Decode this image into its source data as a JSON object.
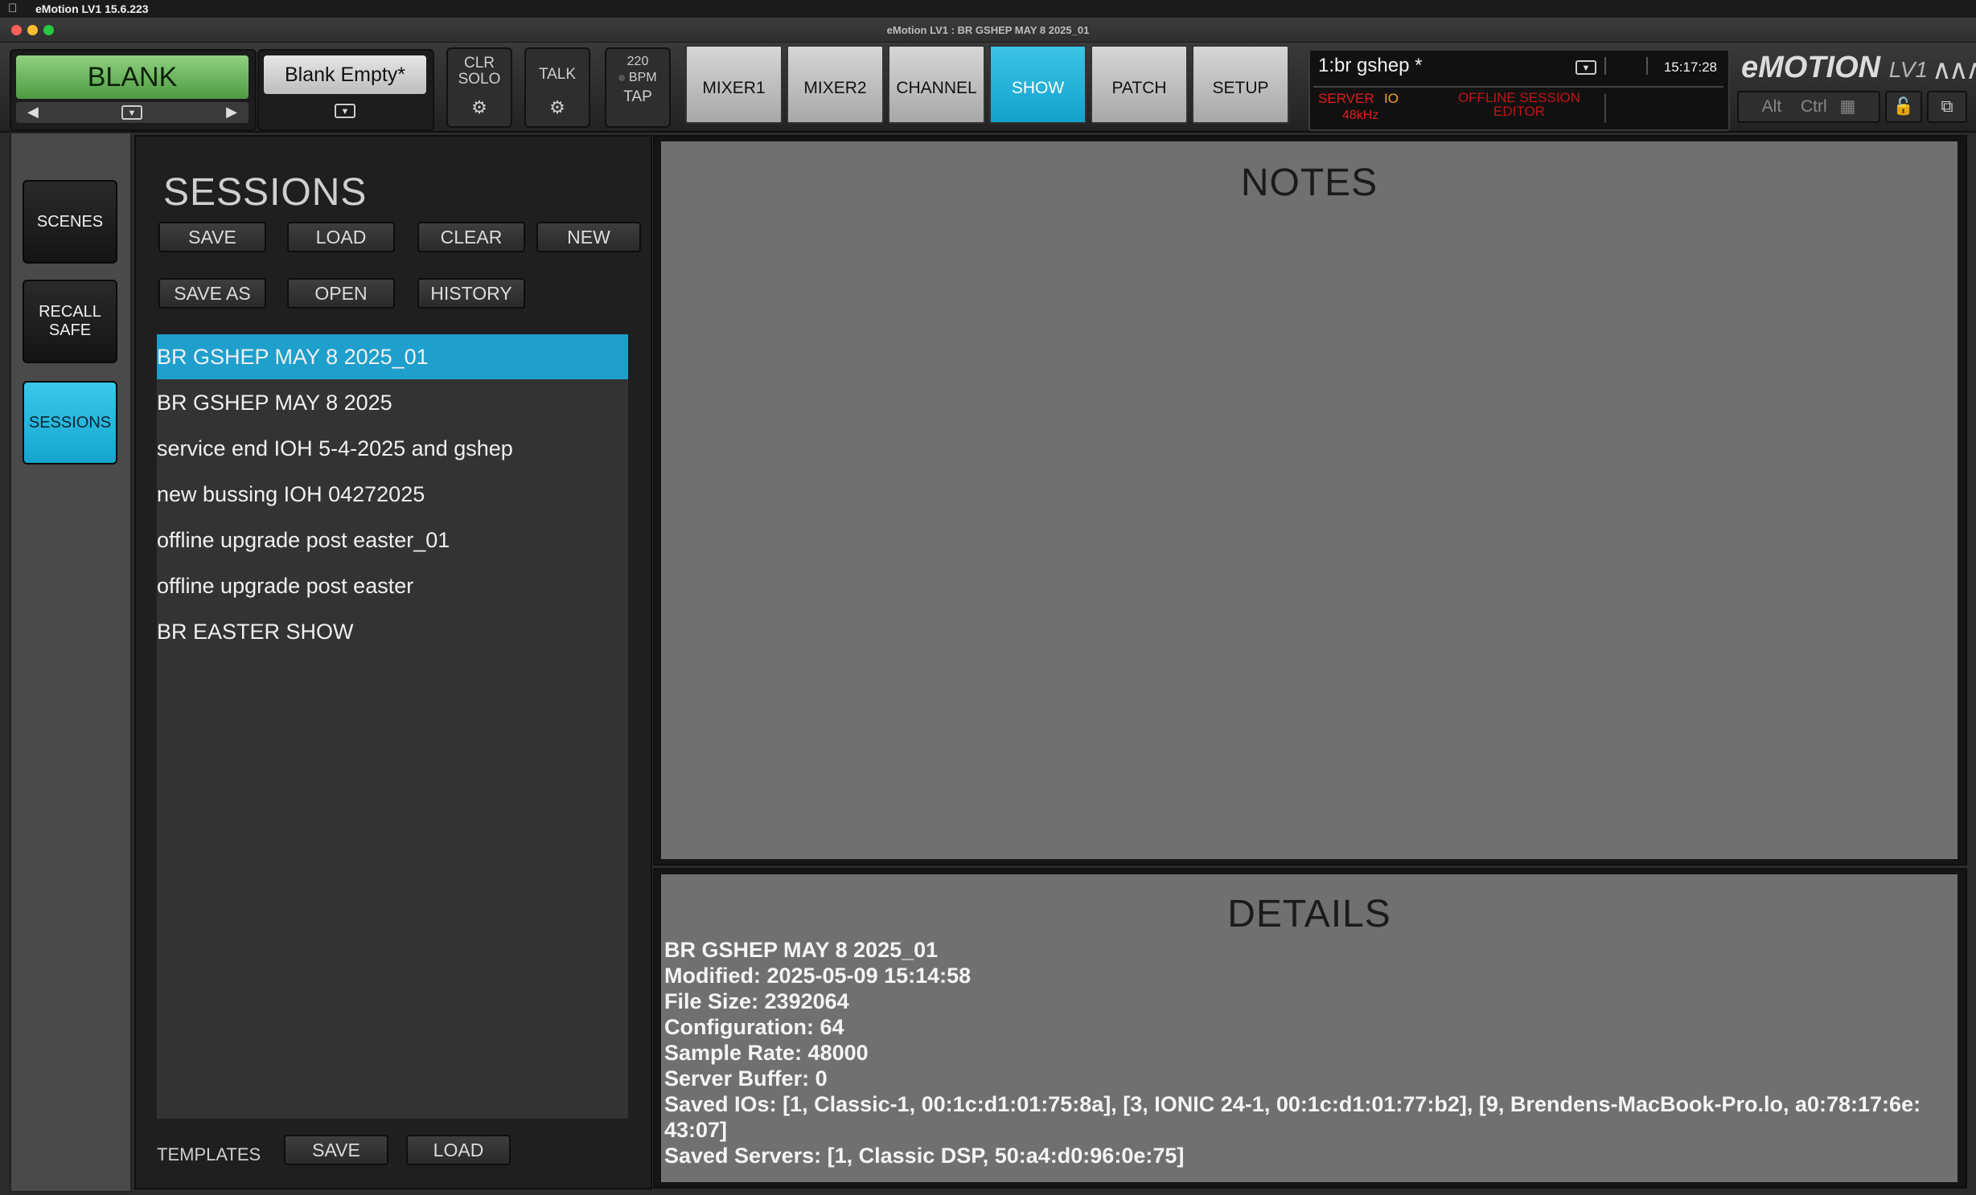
{
  "menubar": {
    "app_name": "eMotion LV1 15.6.223"
  },
  "window": {
    "title": "eMotion LV1 : BR GSHEP MAY 8 2025_01"
  },
  "toolbar": {
    "scene_name": "BLANK",
    "preset_name": "Blank Empty*",
    "clr_solo": "CLR\nSOLO",
    "talk": "TALK",
    "bpm_value": "220",
    "bpm_unit": "BPM",
    "tap": "TAP",
    "tabs": [
      {
        "label": "MIXER1"
      },
      {
        "label": "MIXER2"
      },
      {
        "label": "CHANNEL"
      },
      {
        "label": "SHOW",
        "active": true
      },
      {
        "label": "PATCH"
      },
      {
        "label": "SETUP"
      }
    ],
    "session_title": "1:br gshep *",
    "clock": "15:17:28",
    "server_label": "SERVER",
    "io_label": "IO",
    "sample_rate_label": "48kHz",
    "offline_line1": "OFFLINE SESSION",
    "offline_line2": "EDITOR",
    "logo_main": "eMOTION",
    "logo_suffix": "LV1",
    "alt_label": "Alt",
    "ctrl_label": "Ctrl"
  },
  "sidebar": {
    "items": [
      {
        "label": "SCENES"
      },
      {
        "label": "RECALL\nSAFE"
      },
      {
        "label": "SESSIONS",
        "active": true
      }
    ]
  },
  "sessions": {
    "title": "SESSIONS",
    "buttons_row1": [
      "SAVE",
      "LOAD",
      "CLEAR",
      "NEW"
    ],
    "buttons_row2": [
      "SAVE AS",
      "OPEN",
      "HISTORY"
    ],
    "list": [
      "BR GSHEP MAY 8 2025_01",
      "BR GSHEP MAY 8 2025",
      "service end IOH 5-4-2025 and gshep",
      "new bussing IOH 04272025",
      "offline upgrade post easter_01",
      "offline upgrade post easter",
      "BR EASTER SHOW"
    ],
    "selected_index": 0,
    "templates_label": "TEMPLATES",
    "templates_save": "SAVE",
    "templates_load": "LOAD"
  },
  "notes": {
    "title": "NOTES"
  },
  "details": {
    "title": "DETAILS",
    "lines": [
      "BR GSHEP MAY 8 2025_01",
      "Modified: 2025-05-09 15:14:58",
      "File Size: 2392064",
      "Configuration: 64",
      "Sample Rate: 48000",
      "Server Buffer: 0",
      "Saved IOs: [1, Classic-1, 00:1c:d1:01:75:8a], [3, IONIC 24-1, 00:1c:d1:01:77:b2], [9, Brendens-MacBook-Pro.lo, a0:78:17:6e:",
      "43:07]",
      "Saved Servers: [1, Classic DSP, 50:a4:d0:96:0e:75]"
    ]
  },
  "colors": {
    "accent": "#1e9fcc",
    "scene_green": "#6fb862",
    "alert_red": "#e11d1d",
    "io_orange": "#f3a521"
  }
}
